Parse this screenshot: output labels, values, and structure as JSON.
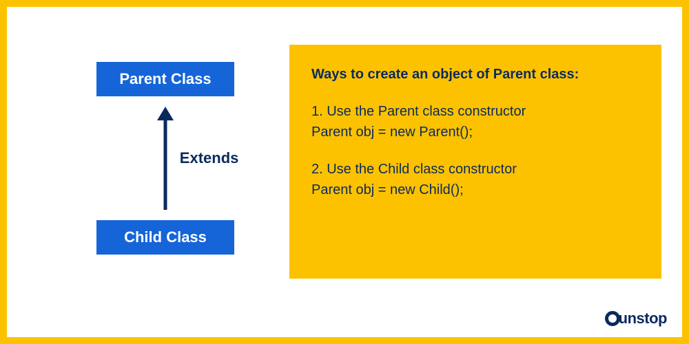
{
  "diagram": {
    "parent_box": "Parent Class",
    "child_box": "Child Class",
    "arrow_label": "Extends"
  },
  "panel": {
    "heading": "Ways to create an object of Parent class:",
    "items": [
      {
        "title": "1. Use the Parent class constructor",
        "code": "Parent obj = new Parent();"
      },
      {
        "title": "2. Use the Child class constructor",
        "code": "Parent obj = new Child();"
      }
    ]
  },
  "brand": {
    "name": "unstop"
  },
  "colors": {
    "accent": "#fcc200",
    "primary": "#1565d8",
    "text": "#0a2a5e"
  }
}
